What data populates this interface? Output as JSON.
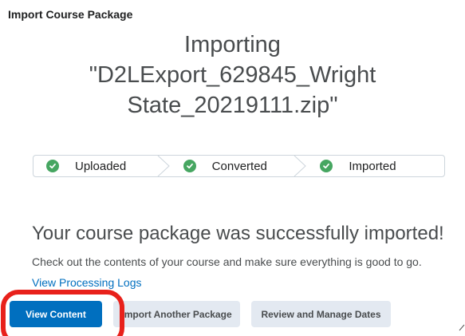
{
  "header": {
    "title": "Import Course Package"
  },
  "import": {
    "title": "Importing\n\"D2LExport_629845_Wright\nState_20219111.zip\""
  },
  "progress": {
    "steps": [
      {
        "label": "Uploaded",
        "status": "complete",
        "icon": "check-circle-icon"
      },
      {
        "label": "Converted",
        "status": "complete",
        "icon": "check-circle-icon"
      },
      {
        "label": "Imported",
        "status": "complete",
        "icon": "check-circle-icon"
      }
    ]
  },
  "result": {
    "title": "Your course package was successfully imported!",
    "description": "Check out the contents of your course and make sure everything is good to go.",
    "logs_link": "View Processing Logs"
  },
  "actions": {
    "view_content": "View Content",
    "import_another": "Import Another Package",
    "review_dates": "Review and Manage Dates"
  },
  "colors": {
    "primary": "#006fbf",
    "success": "#46a661",
    "highlight": "#e8211b",
    "secondary_button": "#e3e9f1"
  }
}
